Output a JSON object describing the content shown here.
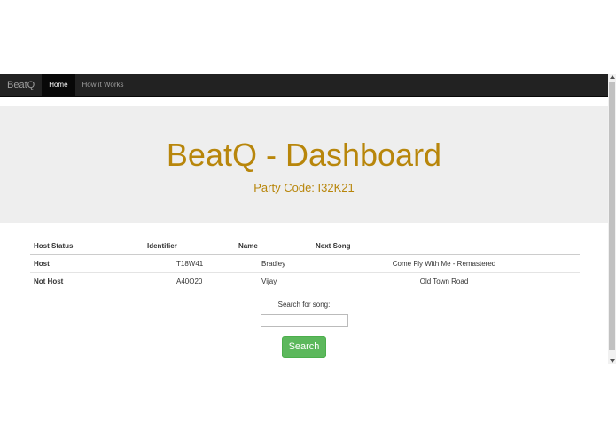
{
  "navbar": {
    "brand": "BeatQ",
    "items": [
      {
        "label": "Home",
        "active": true
      },
      {
        "label": "How it Works",
        "active": false
      }
    ]
  },
  "jumbotron": {
    "title": "BeatQ - Dashboard",
    "subtitle": "Party Code: I32K21",
    "title_color": "#b8860b"
  },
  "table": {
    "headers": [
      "Host Status",
      "Identifier",
      "Name",
      "Next Song"
    ],
    "rows": [
      {
        "status": "Host",
        "identifier": "T18W41",
        "name": "Bradley",
        "next_song": "Come Fly With Me - Remastered"
      },
      {
        "status": "Not Host",
        "identifier": "A40O20",
        "name": "Vijay",
        "next_song": "Old Town Road"
      }
    ]
  },
  "search": {
    "label": "Search for song:",
    "value": "",
    "placeholder": "",
    "button_label": "Search",
    "button_color": "#5cb85c"
  }
}
